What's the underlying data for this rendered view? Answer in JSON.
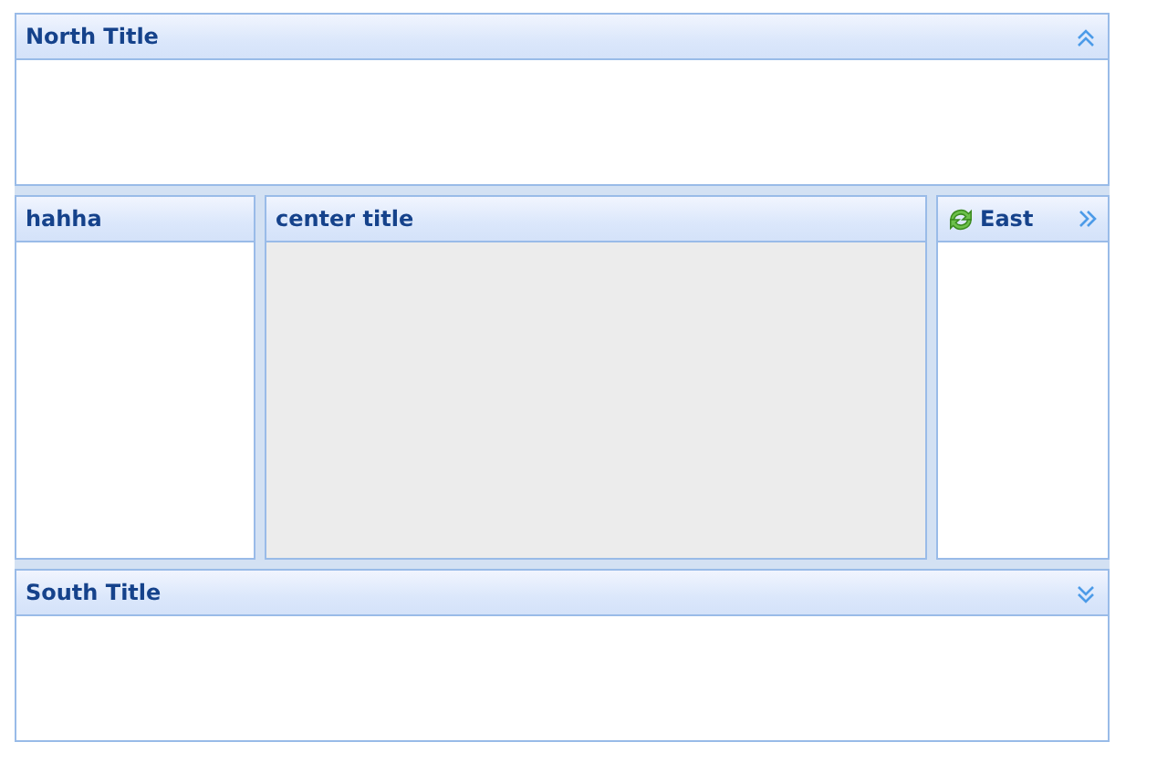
{
  "north": {
    "title": "North Title",
    "kind": "north"
  },
  "west": {
    "title": "hahha"
  },
  "center": {
    "title": "center title",
    "kind": "center"
  },
  "east": {
    "title": "East",
    "kind": "east"
  },
  "south": {
    "title": "South Title",
    "kind": "south"
  }
}
